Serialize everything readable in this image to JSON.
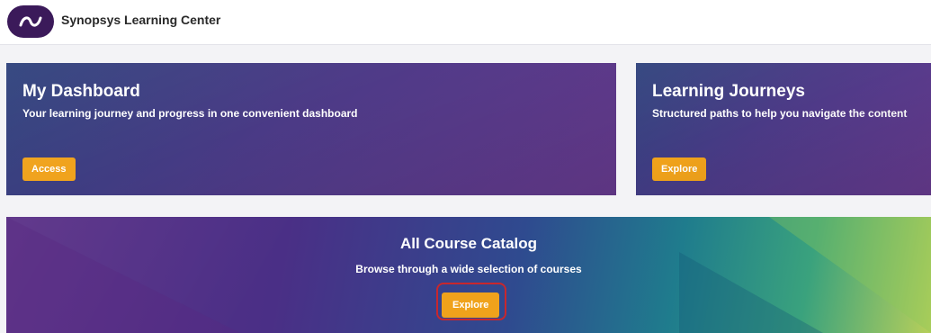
{
  "header": {
    "brand": "Synopsys Learning Center"
  },
  "cards": [
    {
      "title": "My Dashboard",
      "description": "Your learning journey and progress in one convenient dashboard",
      "button_label": "Access"
    },
    {
      "title": "Learning Journeys",
      "description": "Structured paths to help you navigate the content",
      "button_label": "Explore"
    }
  ],
  "banner": {
    "title": "All Course Catalog",
    "description": "Browse through a wide selection of courses",
    "button_label": "Explore"
  },
  "colors": {
    "accent": "#f0a21b",
    "highlight_ring": "#c8272d",
    "card_bg": "#4b3a86"
  }
}
